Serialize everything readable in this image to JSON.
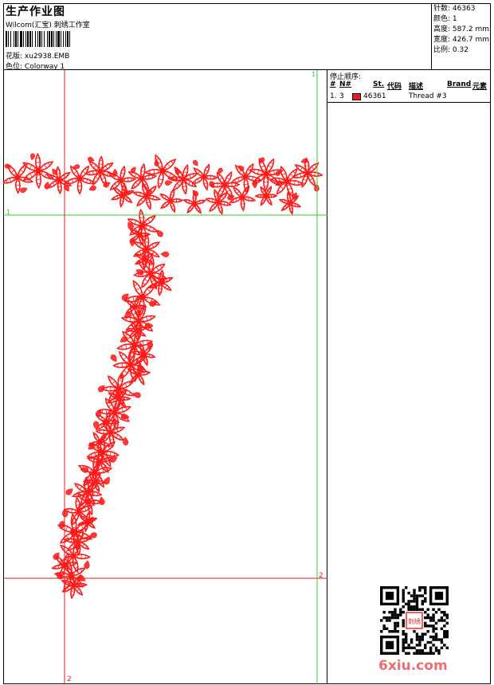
{
  "header": {
    "title": "生产作业图",
    "subtitle": "Wilcom(汇宝) 刺绣工作室",
    "design_label": "花版:",
    "design_value": "xu2938.EMB",
    "colorway_label": "色位:",
    "colorway_value": "Colorway 1"
  },
  "stats": {
    "stitches": "针数: 46363",
    "colors": "颜色: 1",
    "height": "高度: 587.2 mm",
    "width": "宽度: 426.7 mm",
    "scale": "比例: 0.32"
  },
  "stop_sequence": {
    "title": "停止顺序:",
    "columns": {
      "num": "#",
      "n": "N#",
      "st": "St.",
      "code": "代码",
      "desc": "描述",
      "brand": "Brand",
      "element": "元素"
    },
    "rows": [
      {
        "index": "1.",
        "n": "3",
        "swatch_color": "#e81c1c",
        "code": "46361",
        "desc": "Thread #3"
      }
    ]
  },
  "guides": {
    "top_green": "1",
    "right_green": "1",
    "bottom_red": "2",
    "left_red": "2"
  },
  "colors": {
    "thread": "#ff1a1a",
    "guide_green": "#33cc33",
    "guide_red": "#e31e1e",
    "watermark": "#ec6f6f"
  },
  "watermark": "6xiu.com",
  "qr_stamp_text": "刺绣"
}
